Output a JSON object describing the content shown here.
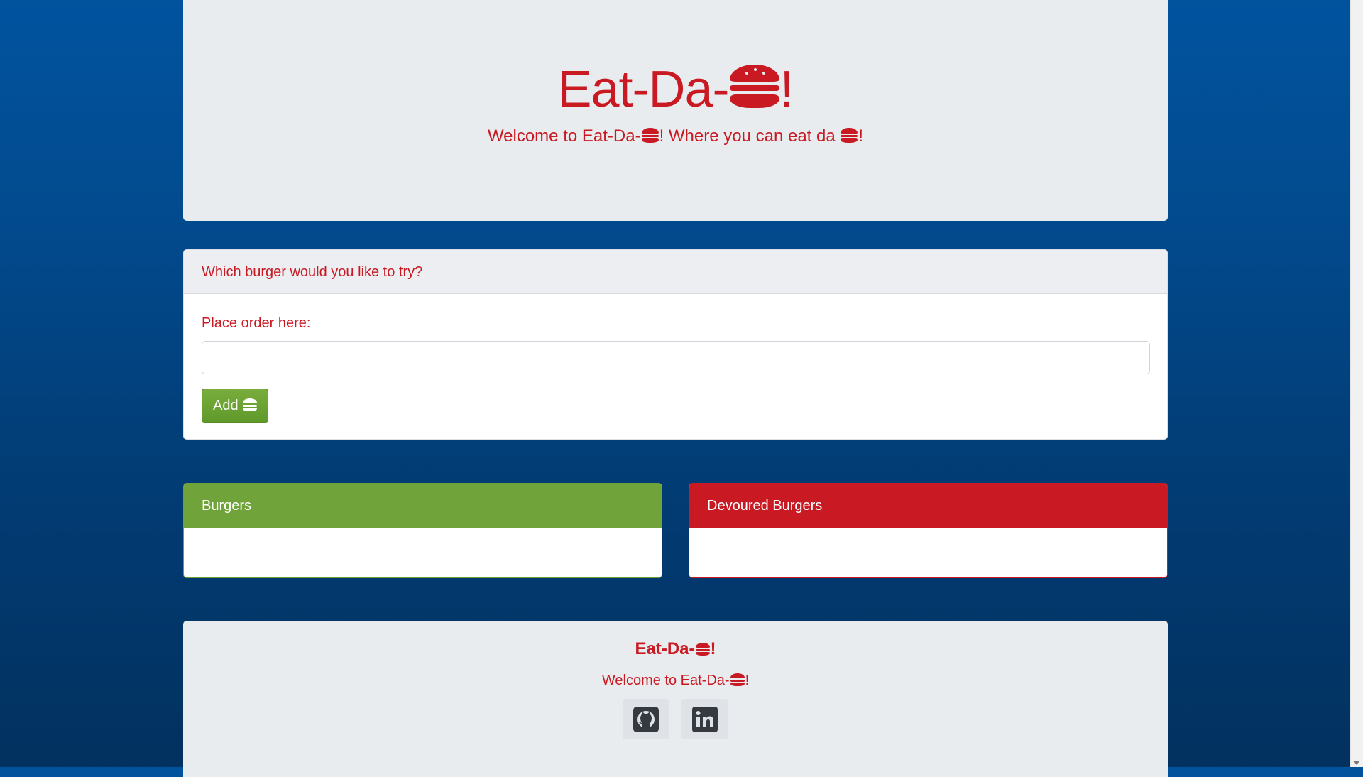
{
  "header": {
    "title_prefix": "Eat-Da-",
    "title_suffix": "!",
    "lead_part1": "Welcome to Eat-Da-",
    "lead_part2": "! Where you can eat da ",
    "lead_part3": "!"
  },
  "order_card": {
    "header": "Which burger would you like to try?",
    "label": "Place order here:",
    "input_value": "",
    "input_placeholder": "",
    "button_label": "Add "
  },
  "burgers_card": {
    "header": "Burgers",
    "items": []
  },
  "devoured_card": {
    "header": "Devoured Burgers",
    "items": []
  },
  "footer": {
    "title_prefix": "Eat-Da-",
    "title_suffix": "!",
    "subtitle_prefix": "Welcome to Eat-Da-",
    "subtitle_suffix": "!",
    "links": [
      {
        "icon": "github-icon"
      },
      {
        "icon": "linkedin-icon"
      }
    ]
  },
  "colors": {
    "accent_red": "#c91a23",
    "accent_green": "#70a43a",
    "panel_gray": "#e9ecef",
    "background_blue": "#01539f"
  }
}
